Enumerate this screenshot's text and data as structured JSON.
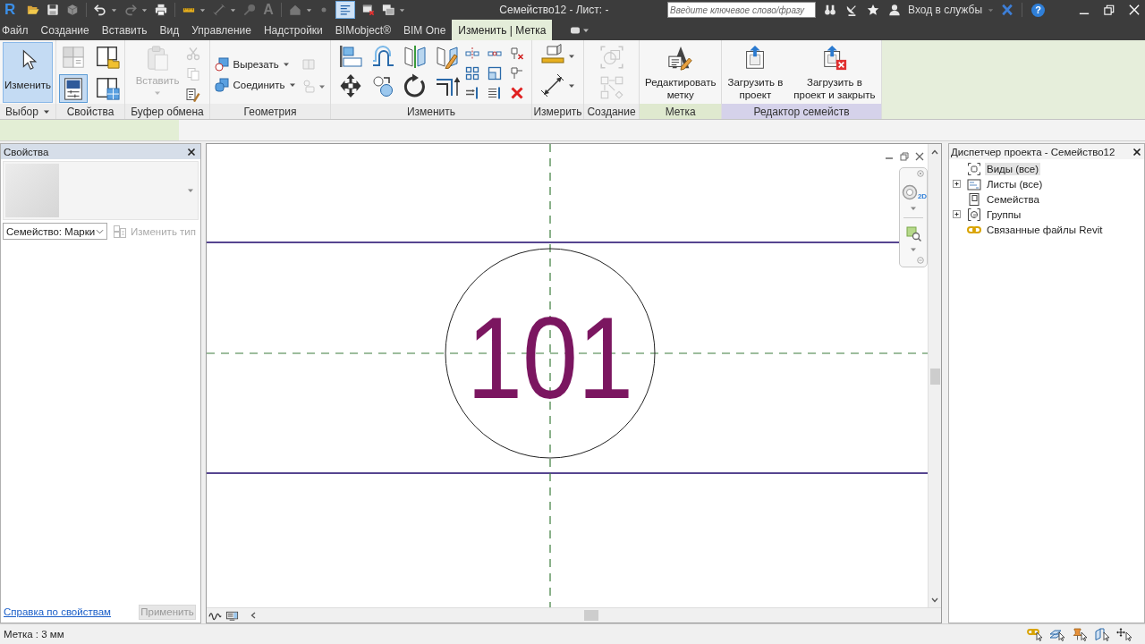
{
  "title_bar": {
    "logo": "R",
    "text_tool": "A",
    "thin_lines_on": true,
    "title": "Семейство12 - Лист: -",
    "search": {
      "placeholder": "Введите ключевое слово/фразу"
    },
    "sign_in": "Вход в службы",
    "help": "?"
  },
  "menu_tabs": [
    {
      "label": "Файл",
      "selected": false
    },
    {
      "label": "Создание",
      "selected": false
    },
    {
      "label": "Вставить",
      "selected": false
    },
    {
      "label": "Вид",
      "selected": false
    },
    {
      "label": "Управление",
      "selected": false
    },
    {
      "label": "Надстройки",
      "selected": false
    },
    {
      "label": "BIMobject®",
      "selected": false
    },
    {
      "label": "BIM One",
      "selected": false
    },
    {
      "label": "Изменить | Метка",
      "selected": true
    }
  ],
  "ribbon": {
    "panels": [
      {
        "kind": "select",
        "label": "Выбор",
        "color": "#ececec",
        "buttons": [
          {
            "label": "Изменить",
            "selected": true
          }
        ]
      },
      {
        "kind": "properties",
        "label": "Свойства",
        "color": "#ececec",
        "toggles": [
          {
            "selected": false
          },
          {
            "selected": false
          },
          {
            "selected": true
          },
          {
            "selected": false
          }
        ]
      },
      {
        "kind": "clipboard",
        "label": "Буфер обмена",
        "color": "#ececec",
        "buttons": [
          {
            "label": "Вставить",
            "disabled": true
          }
        ]
      },
      {
        "kind": "geometry",
        "label": "Геометрия",
        "color": "#ececec",
        "buttons": [
          {
            "label": "Вырезать"
          },
          {
            "label": "Соединить"
          }
        ]
      },
      {
        "kind": "modify",
        "label": "Изменить",
        "color": "#ececec"
      },
      {
        "kind": "measure",
        "label": "Измерить",
        "color": "#ececec"
      },
      {
        "kind": "create",
        "label": "Создание",
        "color": "#ececec"
      },
      {
        "kind": "large",
        "label": "Метка",
        "color": "#dfe9cf",
        "buttons": [
          {
            "label": "Редактировать\nметку"
          }
        ]
      },
      {
        "kind": "large",
        "label": "Редактор семейств",
        "color": "#d5d2ea",
        "buttons": [
          {
            "label": "Загрузить в\nпроект"
          },
          {
            "label": "Загрузить в\nпроект и закрыть"
          }
        ]
      }
    ]
  },
  "properties": {
    "title": "Свойства",
    "family_filter": "Семейство: Марки",
    "edit_type": {
      "label": "Изменить тип",
      "disabled": true
    },
    "help_link": "Справка по свойствам",
    "apply": {
      "label": "Применить",
      "disabled": true
    }
  },
  "view": {
    "nav_wheel_badge": "2D",
    "tag_text": "101"
  },
  "project_browser": {
    "title": "Диспетчер проекта - Семейство12",
    "items": [
      {
        "label": "Виды (все)",
        "selected": true,
        "collapsed": false
      },
      {
        "label": "Листы (все)",
        "selected": false,
        "collapsed": true
      },
      {
        "label": "Семейства",
        "selected": false,
        "collapsed": false
      },
      {
        "label": "Группы",
        "selected": false,
        "collapsed": true
      },
      {
        "label": "Связанные файлы Revit",
        "selected": false,
        "collapsed": false
      }
    ]
  },
  "status_bar": {
    "text": "Метка : 3 мм"
  }
}
